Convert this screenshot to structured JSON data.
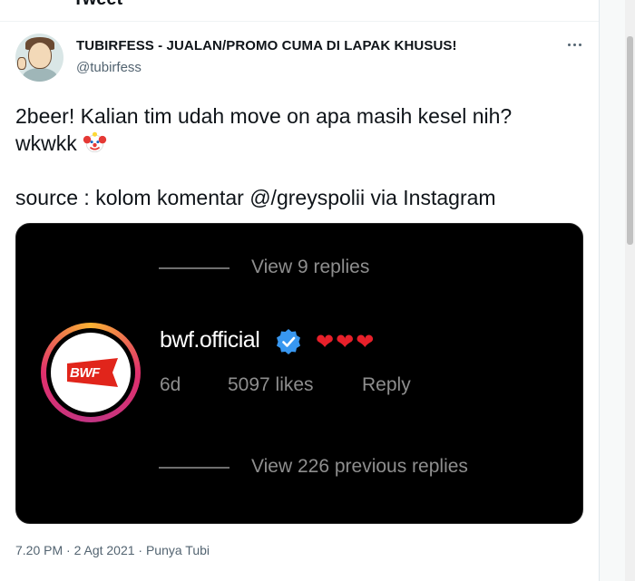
{
  "header": {
    "title": "Tweet"
  },
  "tweet": {
    "display_name": "TUBIRFESS - JUALAN/PROMO CUMA DI LAPAK KHUSUS!",
    "handle": "@tubirfess",
    "text_line1": "2beer! Kalian tim udah move on apa masih kesel nih?",
    "text_line2": "wkwkk",
    "text_line3": "source : kolom komentar @/greyspolii via Instagram",
    "emoji_icon": "clown-face-icon",
    "footer": "7.20 PM · 2 Agt 2021 · Punya Tubi"
  },
  "media": {
    "view_replies_top": "View 9 replies",
    "username": "bwf.official",
    "logo_text": "BWF",
    "hearts": "❤❤❤",
    "age": "6d",
    "likes": "5097 likes",
    "reply_label": "Reply",
    "view_replies_bottom": "View 226 previous replies",
    "colors": {
      "background": "#000000",
      "heart": "#e8202a",
      "verified": "#3897f0",
      "bwf_red": "#e1251b"
    }
  }
}
